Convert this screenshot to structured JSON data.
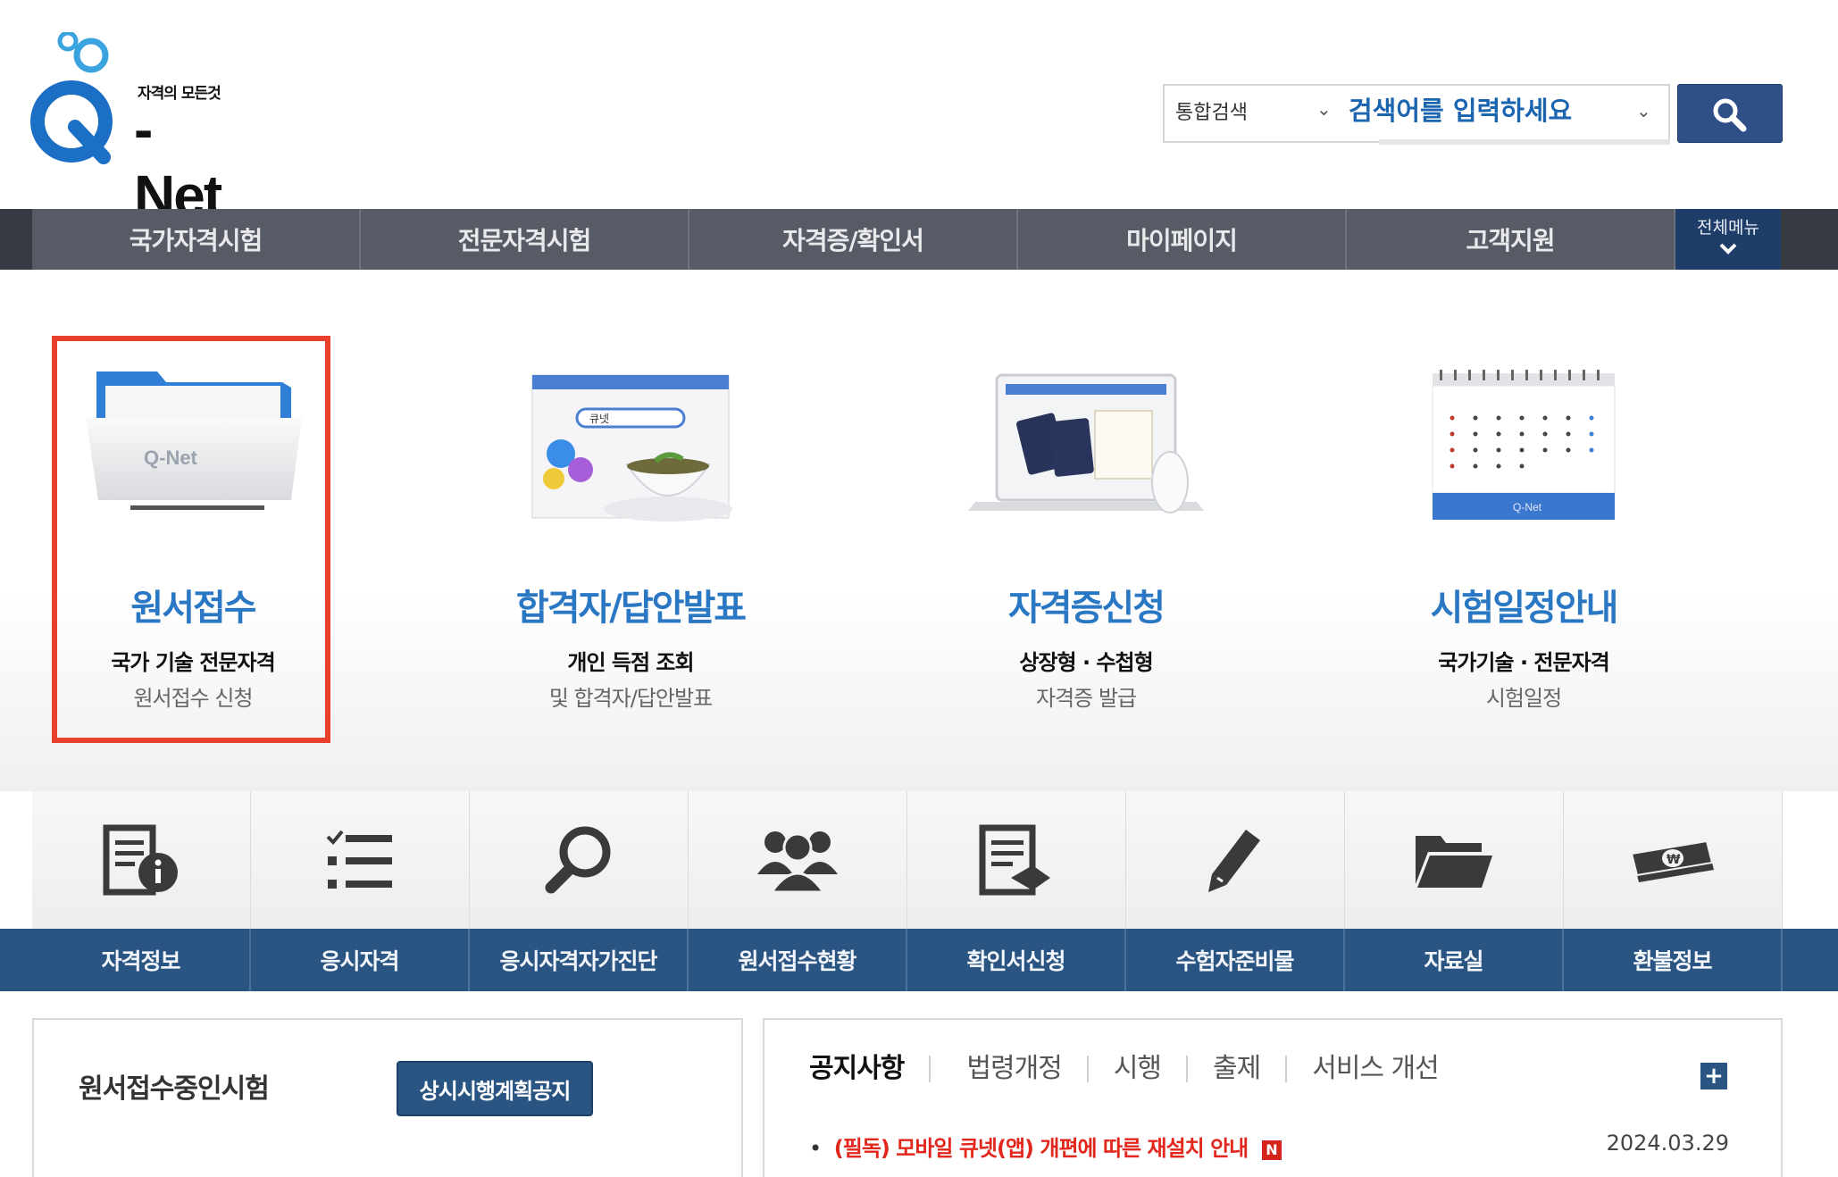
{
  "logo": {
    "tagline": "자격의 모든것",
    "name": "-Net",
    "icon": "q-net-logo-icon"
  },
  "search": {
    "category": "통합검색",
    "placeholder": "검색어를 입력하세요",
    "button_icon": "search-icon"
  },
  "gnb": {
    "items": [
      "국가자격시험",
      "전문자격시험",
      "자격증/확인서",
      "마이페이지",
      "고객지원"
    ],
    "all_menu": "전체메뉴"
  },
  "hero": {
    "cards": [
      {
        "title": "원서접수",
        "sub1": "국가 기술 전문자격",
        "sub2": "원서접수 신청",
        "icon": "folder-icon",
        "folder_text": "Q-Net"
      },
      {
        "title": "합격자/답안발표",
        "sub1": "개인 득점 조회",
        "sub2": "및 합격자/답안발표",
        "icon": "browser-teacup-icon",
        "search_text": "큐넷"
      },
      {
        "title": "자격증신청",
        "sub1": "상장형 · 수첩형",
        "sub2": "자격증 발급",
        "icon": "laptop-certificate-icon"
      },
      {
        "title": "시험일정안내",
        "sub1": "국가기술 · 전문자격",
        "sub2": "시험일정",
        "icon": "calendar-icon",
        "calendar_text": "Q-Net"
      }
    ]
  },
  "quick": {
    "items": [
      {
        "label": "자격정보",
        "icon": "document-info-icon"
      },
      {
        "label": "응시자격",
        "icon": "checklist-icon"
      },
      {
        "label": "응시자격자가진단",
        "icon": "magnifier-icon"
      },
      {
        "label": "원서접수현황",
        "icon": "users-group-icon"
      },
      {
        "label": "확인서신청",
        "icon": "document-send-icon"
      },
      {
        "label": "수험자준비물",
        "icon": "pencil-icon"
      },
      {
        "label": "자료실",
        "icon": "folder-open-icon"
      },
      {
        "label": "환불정보",
        "icon": "money-won-icon"
      }
    ]
  },
  "exam_box": {
    "title": "원서접수중인시험",
    "button": "상시시행계획공지"
  },
  "notice_box": {
    "tabs": [
      "공지사항",
      "법령개정",
      "시행",
      "출제",
      "서비스 개선"
    ],
    "more": "+",
    "items": [
      {
        "bullet": "•",
        "title": "(필독) 모바일 큐넷(앱) 개편에 따른 재설치 안내",
        "badge": "N",
        "date": "2024.03.29"
      }
    ]
  },
  "colors": {
    "accent": "#2a78c4",
    "nav_bg": "#565b66",
    "quick_bar": "#2a5583",
    "highlight": "#e8402c",
    "notice_red": "#e2261c"
  }
}
